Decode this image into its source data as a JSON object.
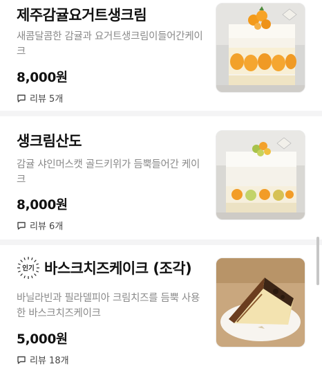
{
  "menu": {
    "items": [
      {
        "name": "제주감귤요거트생크림",
        "description": "새콤달콤한 감귤과 요거트생크림이들어간케이크",
        "price": "8,000원",
        "review_label": "리뷰 5개",
        "badge": null,
        "image_icon": "tangerine-yogurt-cake-photo"
      },
      {
        "name": "생크림산도",
        "description": "감귤 샤인머스캣 골드키위가 듬뿍들어간 케이크",
        "price": "8,000원",
        "review_label": "리뷰 6개",
        "badge": null,
        "image_icon": "cream-sando-cake-photo"
      },
      {
        "name": "바스크치즈케이크 (조각)",
        "description": "바닐라빈과 필라델피아 크림치즈를 듬뿍 사용한 바스크치즈케이크",
        "price": "5,000원",
        "review_label": "리뷰 18개",
        "badge": "인기",
        "image_icon": "basque-cheesecake-photo"
      }
    ]
  },
  "colors": {
    "text": "#111111",
    "muted": "#8a8a8a",
    "divider": "#f4f4f5",
    "scrollbar": "#c6c6c6"
  }
}
